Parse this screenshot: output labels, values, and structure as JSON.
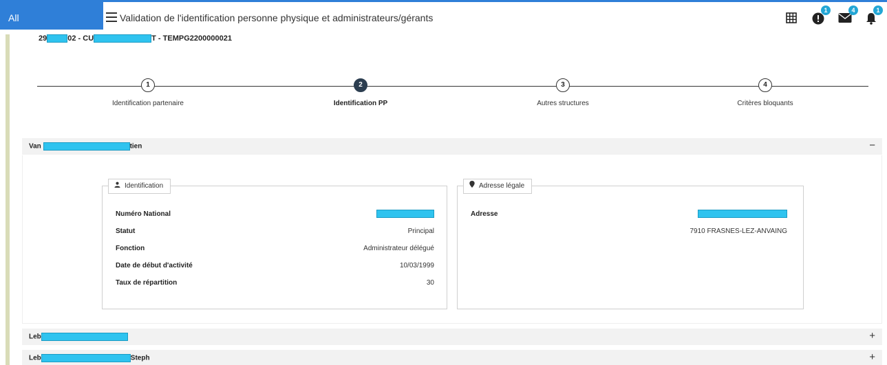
{
  "topbar": {
    "all_label": "All",
    "title": "Validation de l'identification personne physique et administrateurs/gérants",
    "icons": [
      {
        "name": "grid-icon",
        "badge": ""
      },
      {
        "name": "alert-icon",
        "badge": "1"
      },
      {
        "name": "mail-icon",
        "badge": "4"
      },
      {
        "name": "bell-icon",
        "badge": "1"
      }
    ]
  },
  "record": {
    "part1": "29",
    "part2": "02 - CU",
    "part3": "T - TEMPG2200000021"
  },
  "stepper": {
    "steps": [
      {
        "number": "1",
        "label": "Identification partenaire",
        "active": false
      },
      {
        "number": "2",
        "label": "Identification PP",
        "active": true
      },
      {
        "number": "3",
        "label": "Autres structures",
        "active": false
      },
      {
        "number": "4",
        "label": "Critères bloquants",
        "active": false
      }
    ]
  },
  "accordions": [
    {
      "title_start": "Van",
      "title_end": "tien",
      "toggle": "−",
      "expanded": true
    },
    {
      "title_start": "Leb",
      "title_end": "",
      "toggle": "+",
      "expanded": false
    },
    {
      "title_start": "Leb",
      "title_end": "Steph",
      "toggle": "+",
      "expanded": false
    }
  ],
  "identification": {
    "legend": "Identification",
    "fields": [
      {
        "label": "Numéro National",
        "value": ""
      },
      {
        "label": "Statut",
        "value": "Principal"
      },
      {
        "label": "Fonction",
        "value": "Administrateur délégué"
      },
      {
        "label": "Date de début d'activité",
        "value": "10/03/1999"
      },
      {
        "label": "Taux de répartition",
        "value": "30"
      }
    ]
  },
  "address": {
    "legend": "Adresse légale",
    "label": "Adresse",
    "line1": "",
    "line2": "7910 FRASNES-LEZ-ANVAING"
  },
  "colors": {
    "accent": "#2f7fd8",
    "badge": "#23a6d5",
    "redaction": "#2fc3ef",
    "active_step": "#2c3e50"
  }
}
